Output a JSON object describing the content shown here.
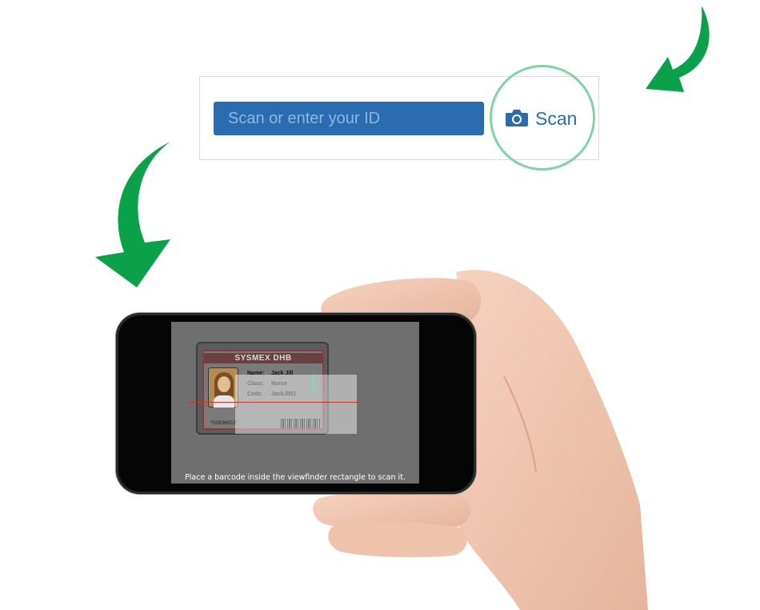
{
  "scan_form": {
    "id_input": {
      "placeholder": "Scan or enter your ID",
      "value": ""
    },
    "scan_button": {
      "label": "Scan",
      "icon": "camera-icon"
    }
  },
  "phone": {
    "camera_preview": {
      "badge": {
        "organization": "SYSMEX DHB",
        "fields": [
          {
            "key": "Name:",
            "value": "Jack Jill"
          },
          {
            "key": "Class:",
            "value": "Nurse"
          },
          {
            "key": "Code:",
            "value": "JackJ001"
          }
        ],
        "number": "*02636022*",
        "logo_letter": "I"
      },
      "hint": "Place a barcode inside the viewfinder rectangle to scan it."
    }
  },
  "colors": {
    "accent": "#2b6cb0",
    "arrow": "#0aa14a",
    "highlight_ring": "#7fd3a6"
  }
}
